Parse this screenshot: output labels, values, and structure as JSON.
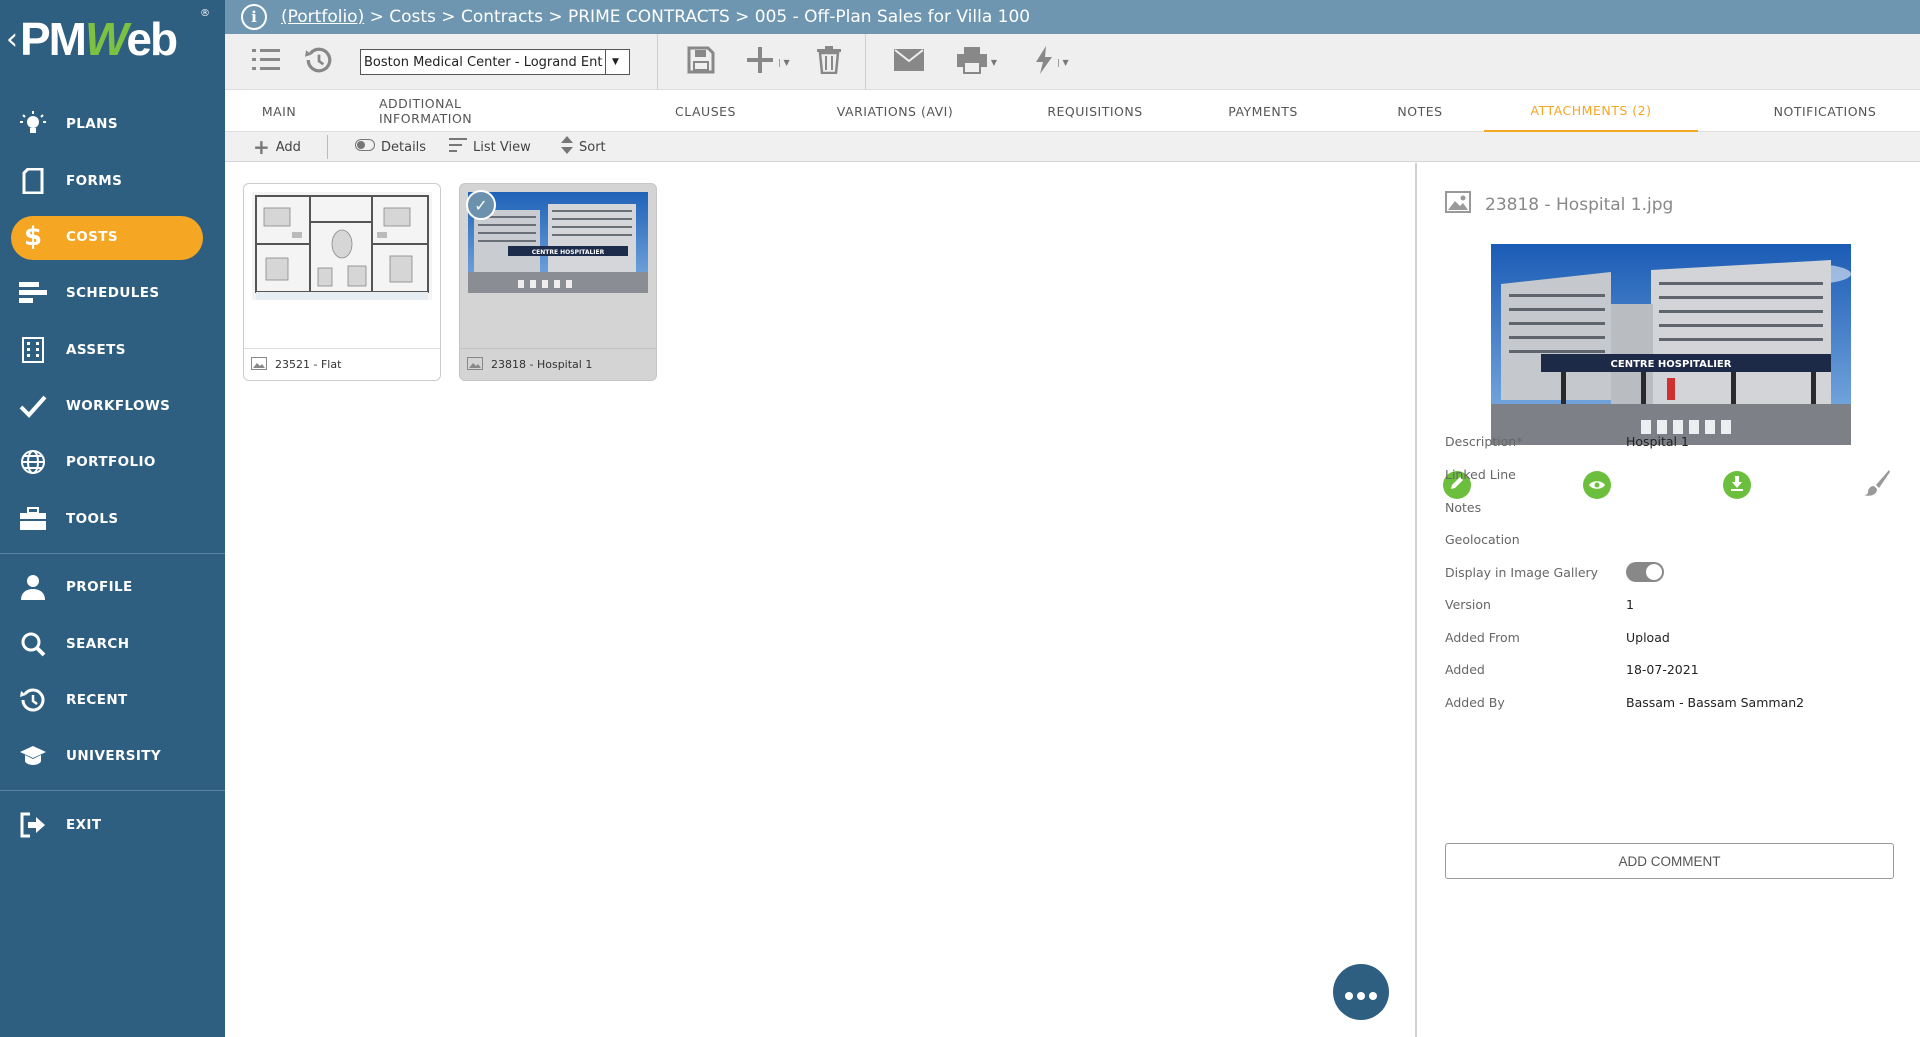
{
  "app": {
    "logo_prefix": "PM",
    "logo_accent": "W",
    "logo_suffix": "eb",
    "logo_reg": "®"
  },
  "breadcrumb": {
    "link": "(Portfolio)",
    "rest": " > Costs > Contracts > PRIME CONTRACTS > 005 - Off-Plan Sales for Villa 100"
  },
  "sidebar": {
    "items": [
      {
        "label": "PLANS",
        "icon": "lightbulb-icon"
      },
      {
        "label": "FORMS",
        "icon": "document-icon"
      },
      {
        "label": "COSTS",
        "icon": "dollar-icon",
        "active": true
      },
      {
        "label": "SCHEDULES",
        "icon": "gantt-icon"
      },
      {
        "label": "ASSETS",
        "icon": "building-icon"
      },
      {
        "label": "WORKFLOWS",
        "icon": "checkmark-icon"
      },
      {
        "label": "PORTFOLIO",
        "icon": "globe-icon"
      },
      {
        "label": "TOOLS",
        "icon": "briefcase-icon"
      },
      {
        "label": "PROFILE",
        "icon": "user-icon"
      },
      {
        "label": "SEARCH",
        "icon": "search-icon"
      },
      {
        "label": "RECENT",
        "icon": "history-icon"
      },
      {
        "label": "UNIVERSITY",
        "icon": "graduation-cap-icon"
      },
      {
        "label": "EXIT",
        "icon": "exit-icon"
      }
    ]
  },
  "toolbar": {
    "project_value": "Boston Medical Center - Logrand Ent"
  },
  "tabs": [
    {
      "label": "MAIN"
    },
    {
      "label": "ADDITIONAL INFORMATION"
    },
    {
      "label": "CLAUSES"
    },
    {
      "label": "VARIATIONS (AVI)"
    },
    {
      "label": "REQUISITIONS"
    },
    {
      "label": "PAYMENTS"
    },
    {
      "label": "NOTES"
    },
    {
      "label": "ATTACHMENTS (2)",
      "active": true
    },
    {
      "label": "NOTIFICATIONS"
    }
  ],
  "subtoolbar": {
    "add": "Add",
    "details": "Details",
    "list_view": "List View",
    "sort": "Sort"
  },
  "attachments": [
    {
      "caption": "23521 - Flat",
      "selected": false
    },
    {
      "caption": "23818 - Hospital 1",
      "selected": true
    }
  ],
  "detail": {
    "title": "23818 - Hospital 1.jpg",
    "preview_sign": "CENTRE  HOSPITALIER",
    "thumb_sign": "CENTRE HOSPITALIER",
    "fields": {
      "description_label": "Description*",
      "description_value": "Hospital 1",
      "linked_line_label": "Linked Line",
      "notes_label": "Notes",
      "geolocation_label": "Geolocation",
      "gallery_label": "Display in Image Gallery",
      "version_label": "Version",
      "version_value": "1",
      "added_from_label": "Added From",
      "added_from_value": "Upload",
      "added_label": "Added",
      "added_value": "18-07-2021",
      "added_by_label": "Added By",
      "added_by_value": "Bassam - Bassam Samman2"
    },
    "gallery_on": true,
    "add_comment": "ADD COMMENT"
  },
  "colors": {
    "sidebar": "#2e5f80",
    "accent": "#f5a623",
    "header": "#6e96b0",
    "action_green": "#6cbf3c"
  }
}
